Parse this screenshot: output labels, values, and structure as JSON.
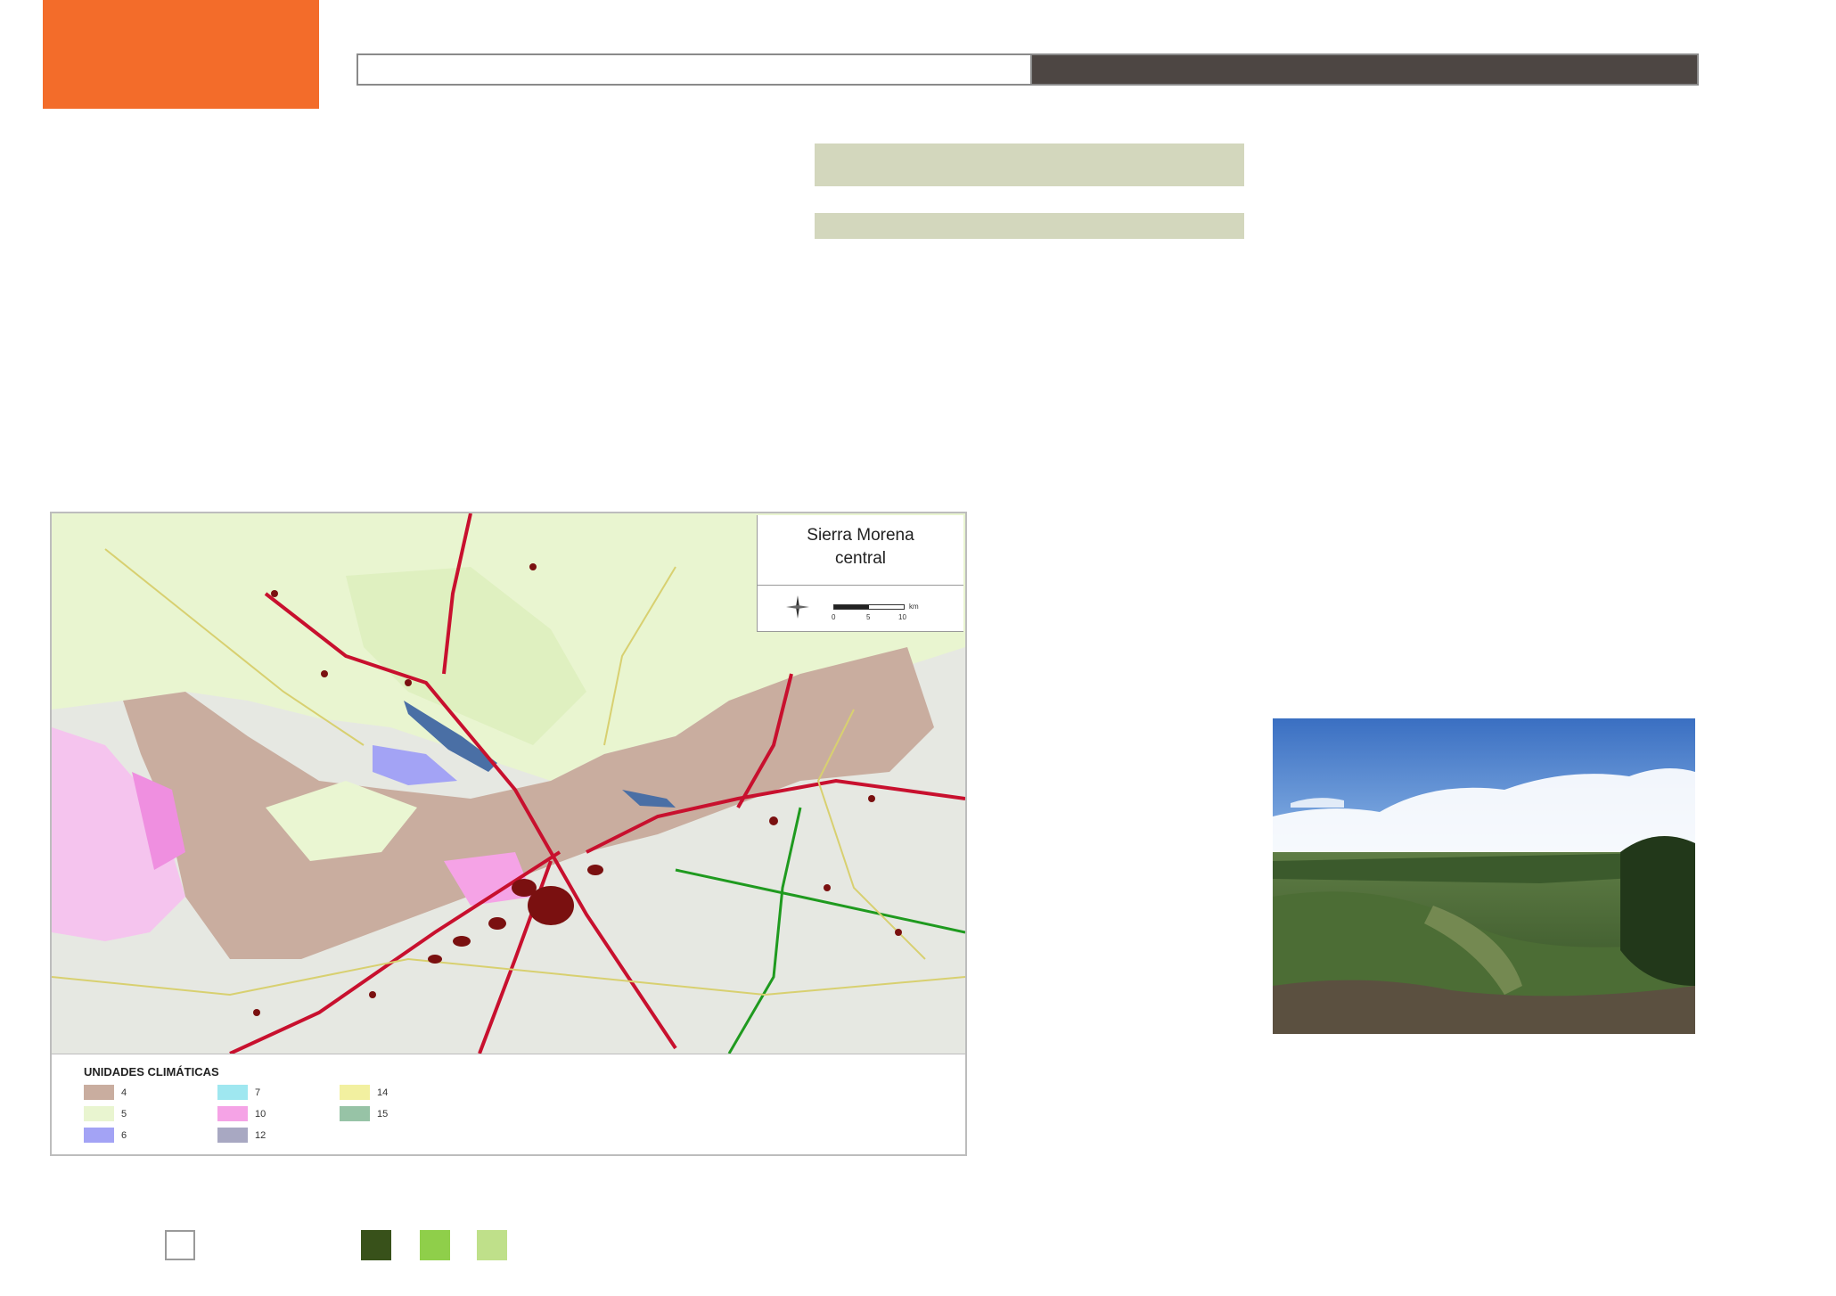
{
  "map": {
    "title_line1": "Sierra Morena",
    "title_line2": "central",
    "scale_ticks": [
      "0",
      "5",
      "10"
    ],
    "scale_unit": "km",
    "legend_title": "UNIDADES CLIMÁTICAS",
    "legend": [
      {
        "label": "4",
        "color": "#c9ad9f"
      },
      {
        "label": "5",
        "color": "#e9f5d0"
      },
      {
        "label": "6",
        "color": "#a3a3f5"
      },
      {
        "label": "7",
        "color": "#9fe7f0"
      },
      {
        "label": "10",
        "color": "#f5a3e6"
      },
      {
        "label": "12",
        "color": "#a8a8c2"
      },
      {
        "label": "14",
        "color": "#f2f0a0"
      },
      {
        "label": "15",
        "color": "#97c3a6"
      }
    ],
    "colors": {
      "urban": "#7a1010",
      "highway": "#c8102e",
      "national_road": "#1f9a1f",
      "local_road": "#d8d070",
      "reservoir": "#4a6fa5",
      "relief": "#dcdcdc"
    }
  },
  "header": {
    "accent_color": "#f36c2a",
    "bar_dark_color": "#4d4643",
    "label_bar_color": "#d3d7bd"
  },
  "bottom_swatches": [
    {
      "color": "#38511a"
    },
    {
      "color": "#8fcf4a"
    },
    {
      "color": "#bfe08a"
    }
  ]
}
